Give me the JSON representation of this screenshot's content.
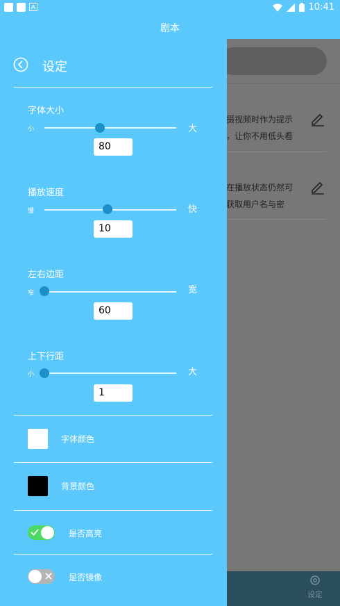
{
  "status_bar": {
    "time": "10:41"
  },
  "app_title": "剧本",
  "background": {
    "items": [
      {
        "line1": "摄视频时作为提示",
        "line2": "，让你不用低头看"
      },
      {
        "line1": "在播放状态仍然可",
        "line2": "获取用户名与密"
      }
    ],
    "bottom_tab_label": "设定"
  },
  "drawer": {
    "title": "设定",
    "sliders": [
      {
        "label": "字体大小",
        "min_label": "小",
        "max_label": "大",
        "value": "80",
        "fraction": 0.42
      },
      {
        "label": "播放速度",
        "min_label": "慢",
        "max_label": "快",
        "value": "10",
        "fraction": 0.48
      },
      {
        "label": "左右边距",
        "min_label": "窄",
        "max_label": "宽",
        "value": "60",
        "fraction": 0.0
      },
      {
        "label": "上下行距",
        "min_label": "小",
        "max_label": "大",
        "value": "1",
        "fraction": 0.0
      }
    ],
    "font_color": {
      "label": "字体颜色",
      "color": "#ffffff"
    },
    "bg_color": {
      "label": "背景颜色",
      "color": "#000000"
    },
    "highlight": {
      "label": "是否高亮",
      "on": true
    },
    "mirror": {
      "label": "是否镜像",
      "on": false
    }
  },
  "colors": {
    "accent": "#5ac8fa",
    "thumb": "#1b8fc9",
    "toggle_on": "#4cd964",
    "toggle_off": "#b5b5b5"
  }
}
